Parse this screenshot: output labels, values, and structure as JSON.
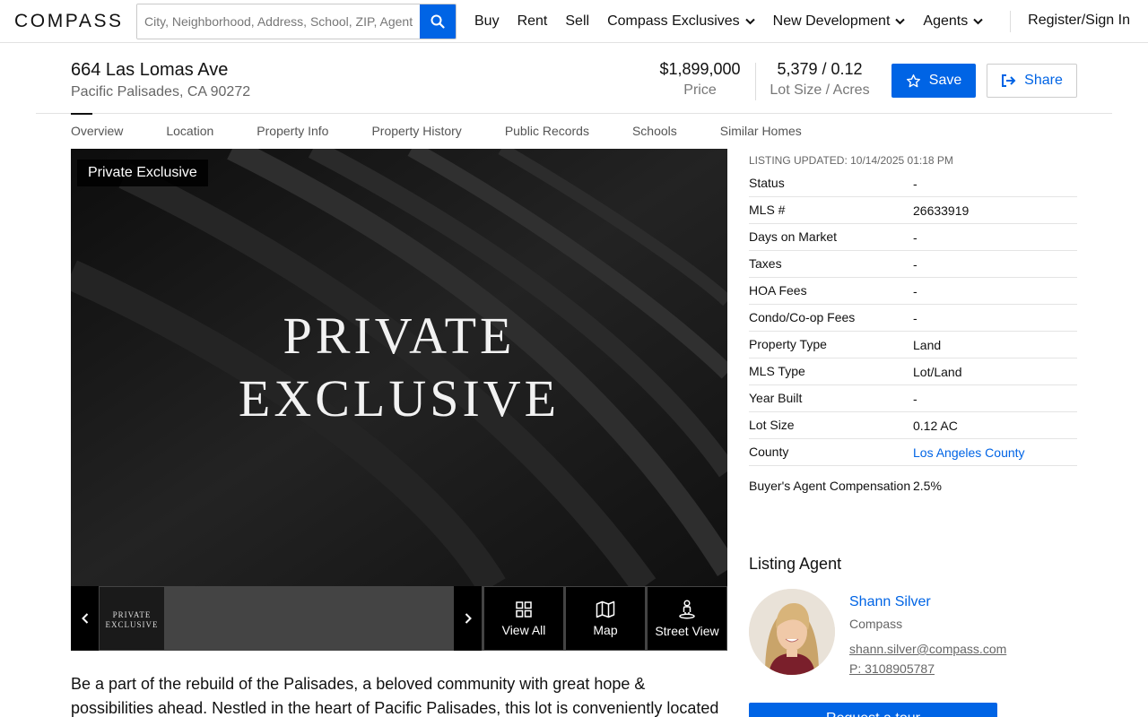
{
  "nav": {
    "logo": "COMPASS",
    "search_placeholder": "City, Neighborhood, Address, School, ZIP, Agent",
    "links": [
      "Buy",
      "Rent",
      "Sell",
      "Compass Exclusives",
      "New Development",
      "Agents"
    ],
    "signin": "Register/Sign In"
  },
  "listing": {
    "address": "664 Las Lomas Ave",
    "city": "Pacific Palisades, CA 90272",
    "price": "$1,899,000",
    "price_label": "Price",
    "lot": "5,379 / 0.12",
    "lot_label": "Lot Size / Acres",
    "save_label": "Save",
    "share_label": "Share"
  },
  "tabs": [
    "Overview",
    "Location",
    "Property Info",
    "Property History",
    "Public Records",
    "Schools",
    "Similar Homes"
  ],
  "gallery": {
    "badge": "Private Exclusive",
    "hero_line1": "PRIVATE",
    "hero_line2": "EXCLUSIVE",
    "thumb_line1": "PRIVATE",
    "thumb_line2": "EXCLUSIVE",
    "view_all": "View All",
    "map": "Map",
    "street_view": "Street View"
  },
  "details": {
    "updated": "LISTING UPDATED: 10/14/2025 01:18 PM",
    "rows": [
      {
        "k": "Status",
        "v": "-"
      },
      {
        "k": "MLS #",
        "v": "26633919"
      },
      {
        "k": "Days on Market",
        "v": "-"
      },
      {
        "k": "Taxes",
        "v": "-"
      },
      {
        "k": "HOA Fees",
        "v": "-"
      },
      {
        "k": "Condo/Co-op Fees",
        "v": "-"
      },
      {
        "k": "Property Type",
        "v": "Land"
      },
      {
        "k": "MLS Type",
        "v": "Lot/Land"
      },
      {
        "k": "Year Built",
        "v": "-"
      },
      {
        "k": "Lot Size",
        "v": "0.12 AC"
      },
      {
        "k": "County",
        "v": "Los Angeles County"
      },
      {
        "k": "Buyer's Agent Compensation",
        "v": "2.5%"
      }
    ]
  },
  "agent": {
    "title": "Listing Agent",
    "name": "Shann Silver",
    "company": "Compass",
    "email": "shann.silver@compass.com",
    "phone": "P: 3108905787",
    "cta": "Request a tour"
  },
  "description": "Be a part of the rebuild of the Palisades, a beloved community with great hope & possibilities ahead. Nestled in the heart of Pacific Palisades, this lot is conveniently located",
  "colors": {
    "accent": "#0064e5",
    "hero_bg": "#1b1b1b"
  }
}
